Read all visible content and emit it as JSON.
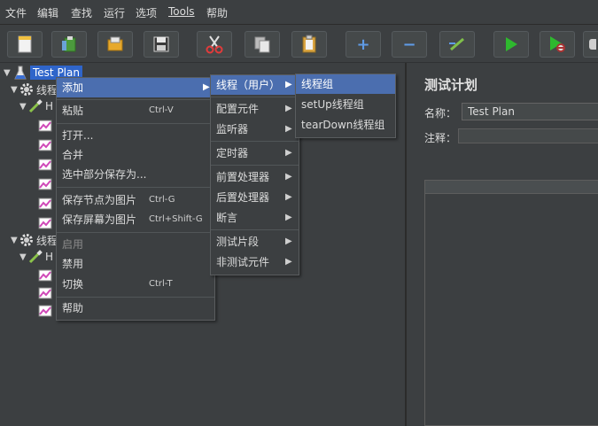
{
  "menubar": {
    "items": [
      "文件",
      "编辑",
      "查找",
      "运行",
      "选项",
      "Tools",
      "帮助"
    ]
  },
  "toolbar": {
    "buttons": [
      {
        "name": "new-icon"
      },
      {
        "name": "templates-icon"
      },
      {
        "name": "open-icon"
      },
      {
        "name": "save-icon"
      },
      {
        "name": "cut-icon"
      },
      {
        "name": "copy-icon"
      },
      {
        "name": "paste-icon"
      },
      {
        "name": "expand-icon",
        "glyph": "+"
      },
      {
        "name": "collapse-icon",
        "glyph": "−"
      },
      {
        "name": "toggle-icon"
      },
      {
        "name": "start-icon"
      },
      {
        "name": "start-no-pauses-icon"
      },
      {
        "name": "stop-icon"
      }
    ]
  },
  "tree": {
    "root_label": "Test Plan",
    "nodes": [
      {
        "text": "线程"
      },
      {
        "text": "H"
      },
      {
        "text": "线程"
      },
      {
        "text": "H"
      }
    ]
  },
  "context_menu": {
    "items": [
      {
        "label": "添加",
        "has_submenu": true,
        "highlighted": true
      },
      {
        "label": "粘贴",
        "shortcut": "Ctrl-V"
      },
      {
        "label": "打开..."
      },
      {
        "label": "合并"
      },
      {
        "label": "选中部分保存为..."
      },
      {
        "label": "保存节点为图片",
        "shortcut": "Ctrl-G"
      },
      {
        "label": "保存屏幕为图片",
        "shortcut": "Ctrl+Shift-G"
      },
      {
        "label": "启用",
        "disabled": true
      },
      {
        "label": "禁用"
      },
      {
        "label": "切换",
        "shortcut": "Ctrl-T"
      },
      {
        "label": "帮助"
      }
    ]
  },
  "add_submenu": {
    "items": [
      {
        "label": "线程（用户）",
        "has_submenu": true,
        "highlighted": true
      },
      {
        "label": "配置元件",
        "has_submenu": true
      },
      {
        "label": "监听器",
        "has_submenu": true
      },
      {
        "label": "定时器",
        "has_submenu": true
      },
      {
        "label": "前置处理器",
        "has_submenu": true
      },
      {
        "label": "后置处理器",
        "has_submenu": true
      },
      {
        "label": "断言",
        "has_submenu": true
      },
      {
        "label": "测试片段",
        "has_submenu": true
      },
      {
        "label": "非测试元件",
        "has_submenu": true
      }
    ]
  },
  "thread_submenu": {
    "items": [
      {
        "label": "线程组",
        "highlighted": true
      },
      {
        "label": "setUp线程组"
      },
      {
        "label": "tearDown线程组"
      }
    ]
  },
  "right_panel": {
    "title": "测试计划",
    "name_label": "名称：",
    "name_value": "Test Plan",
    "comment_label": "注释："
  },
  "colors": {
    "background": "#3c3f41",
    "selection": "#2f65ca",
    "menu_highlight": "#4b6eaf",
    "run_green": "#2eb82e"
  }
}
